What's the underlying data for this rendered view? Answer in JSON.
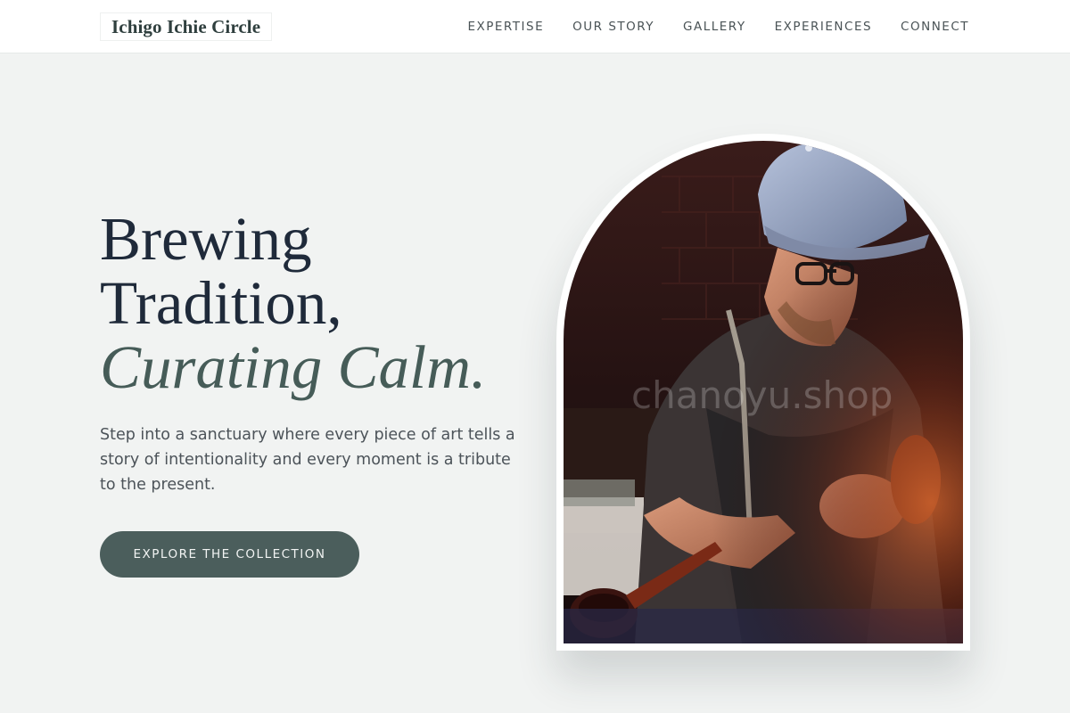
{
  "navbar": {
    "logo": "Ichigo Ichie Circle",
    "links": [
      "EXPERTISE",
      "OUR STORY",
      "GALLERY",
      "EXPERIENCES",
      "CONNECT"
    ]
  },
  "hero": {
    "title_line1": "Brewing",
    "title_line2": "Tradition,",
    "title_accent": "Curating Calm.",
    "description": "Step into a sanctuary where every piece of art tells a story of intentionality and every moment is a tribute to the present.",
    "cta_label": "EXPLORE THE COLLECTION",
    "image": {
      "subject": "craftsman-with-pipe",
      "watermark": "chanoyu.shop"
    }
  },
  "colors": {
    "background": "#f1f3f2",
    "accent": "#465c58",
    "button": "#4b5e5c",
    "heading": "#1f2a3a"
  }
}
